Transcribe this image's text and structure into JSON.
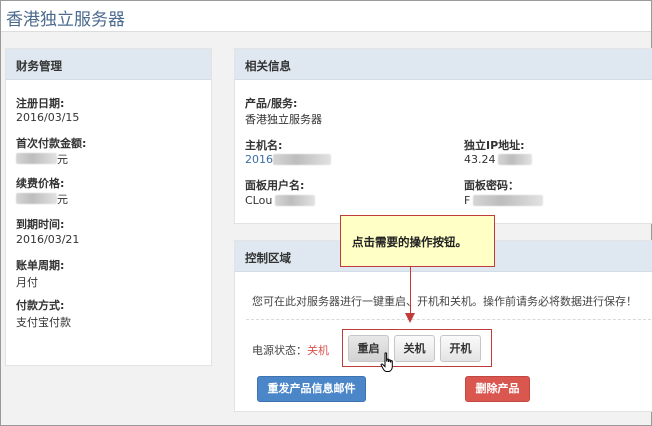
{
  "page": {
    "title": "香港独立服务器"
  },
  "finance": {
    "heading": "财务管理",
    "reg_date_label": "注册日期:",
    "reg_date_value": "2016/03/15",
    "first_payment_label": "首次付款金额:",
    "first_payment_value": "元",
    "renew_price_label": "续费价格:",
    "renew_price_value": "元",
    "due_date_label": "到期时间:",
    "due_date_value": "2016/03/21",
    "billing_cycle_label": "账单周期:",
    "billing_cycle_value": "月付",
    "payment_method_label": "付款方式:",
    "payment_method_value": "支付宝付款"
  },
  "info": {
    "heading": "相关信息",
    "product_label": "产品/服务:",
    "product_value": "香港独立服务器",
    "hostname_label": "主机名:",
    "hostname_value": "2016",
    "ip_label": "独立IP地址:",
    "ip_value": "43.24",
    "panel_user_label": "面板用户名:",
    "panel_user_value": "CLou",
    "panel_pass_label": "面板密码：",
    "panel_pass_value": "F"
  },
  "control": {
    "heading": "控制区域",
    "notice": "您可在此对服务器进行一键重启、开机和关机。操作前请务必将数据进行保存！",
    "power_status_label": "电源状态：",
    "power_status_value": "关机",
    "restart_label": "重启",
    "shutdown_label": "关机",
    "poweron_label": "开机",
    "resend_email_label": "重发产品信息邮件",
    "delete_label": "删除产品"
  },
  "callout": {
    "text": "点击需要的操作按钮。"
  },
  "colors": {
    "title": "#4a6a8e",
    "panel_header": "#dfe8f0",
    "link": "#3a6ea5",
    "power_off": "#d9534f",
    "primary": "#4a86c8",
    "danger": "#d9574f",
    "callout_border": "#c23b3b",
    "callout_bg": "#ffffc6"
  },
  "icons": {
    "cursor": "hand-pointer-icon"
  }
}
